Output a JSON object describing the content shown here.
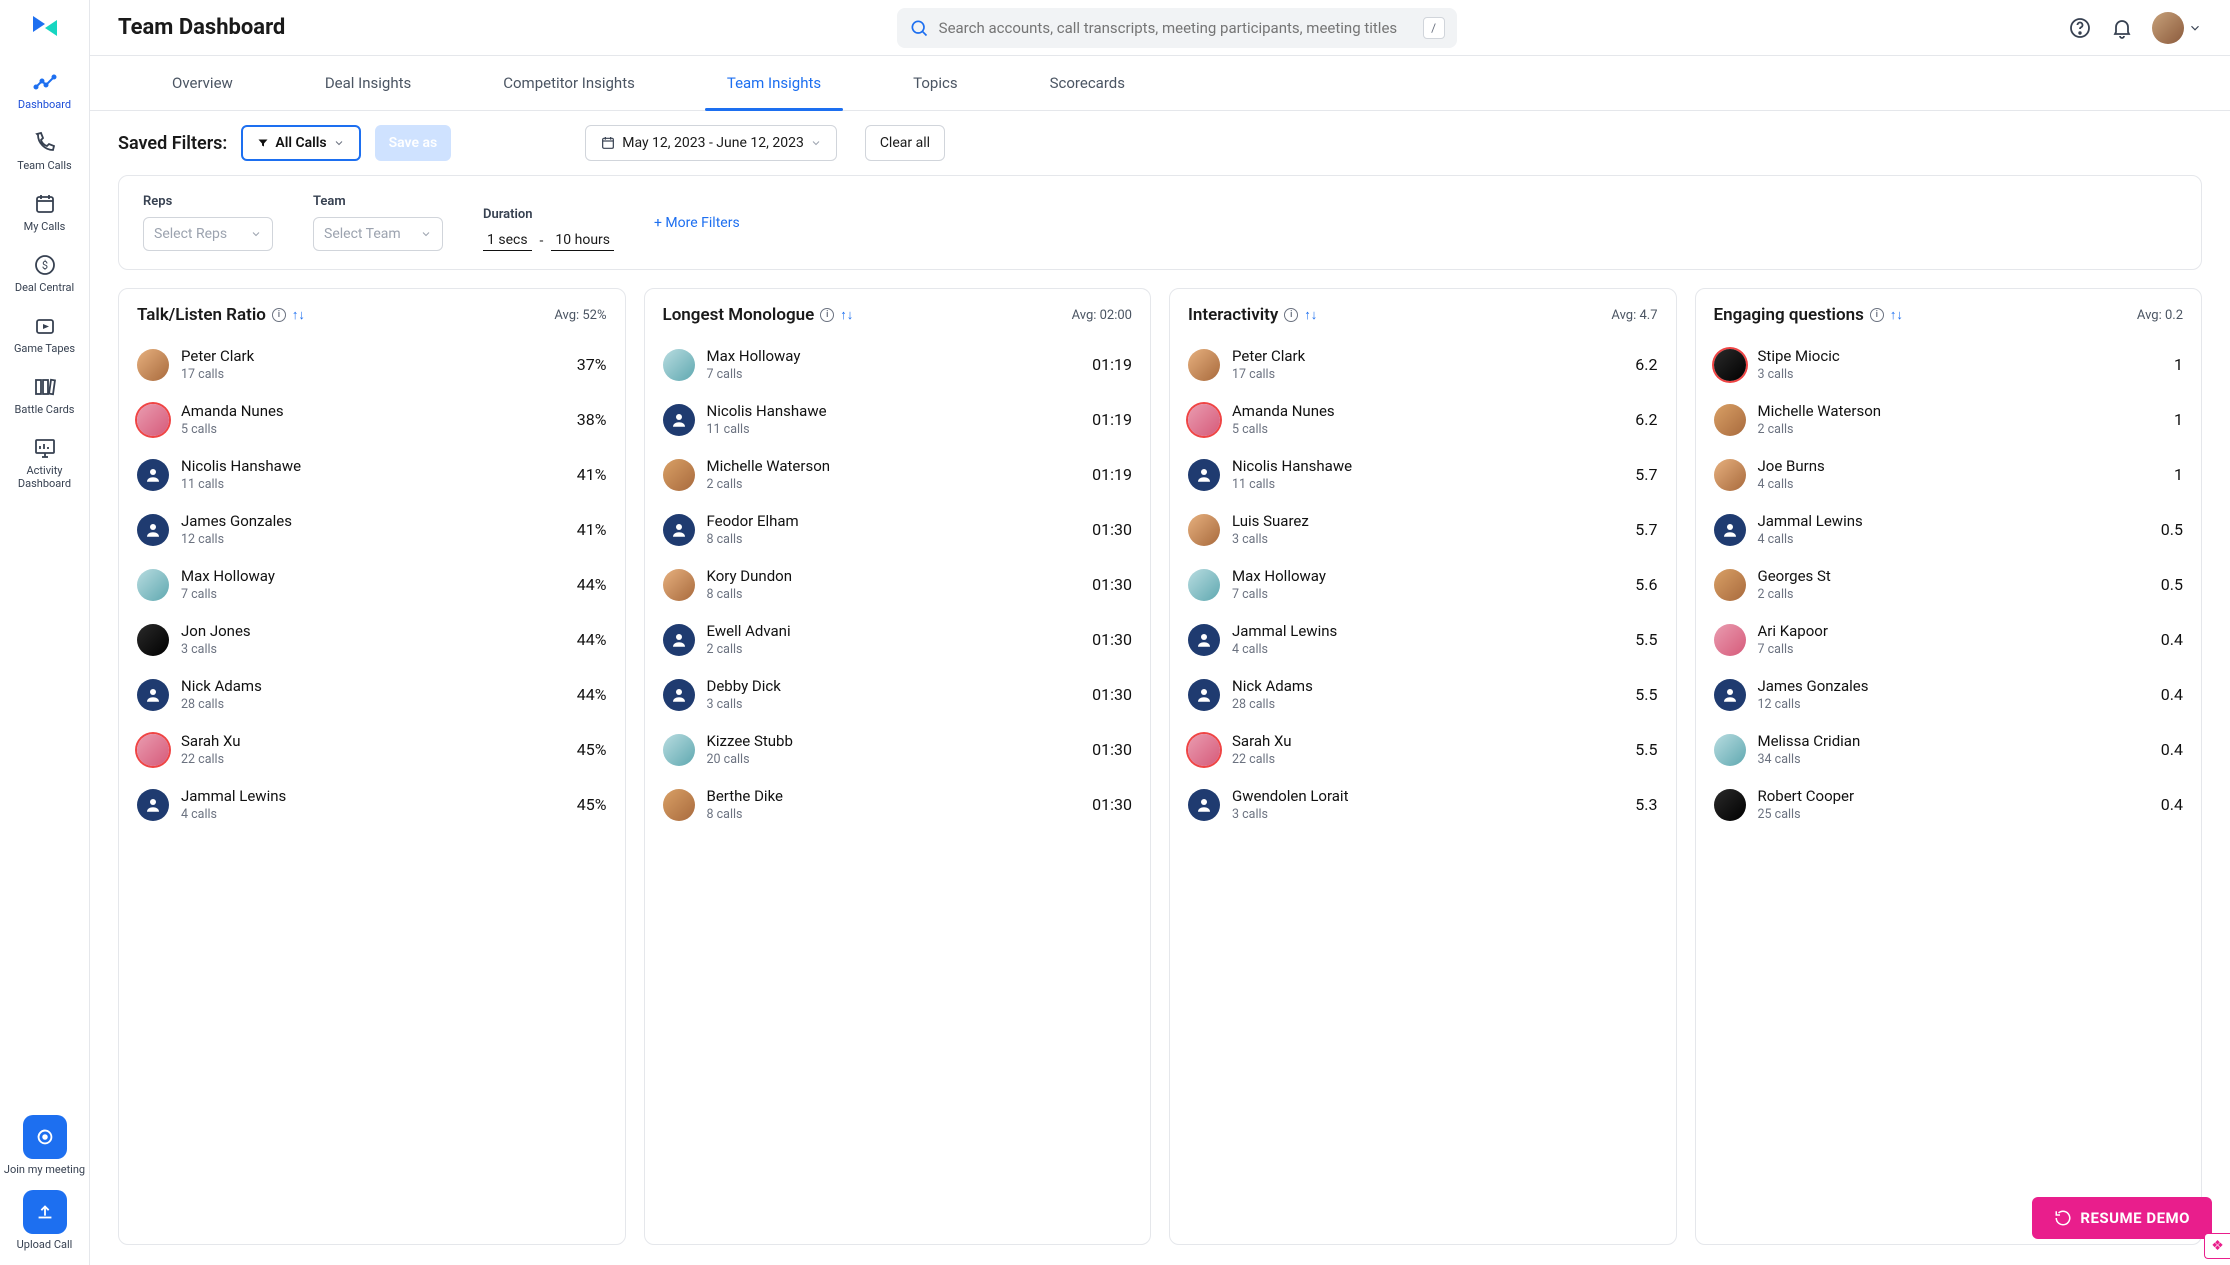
{
  "header": {
    "title": "Team Dashboard",
    "search_placeholder": "Search accounts, call transcripts, meeting participants, meeting titles",
    "search_kbd": "/"
  },
  "sidenav": {
    "items": [
      {
        "label": "Dashboard"
      },
      {
        "label": "Team Calls"
      },
      {
        "label": "My Calls"
      },
      {
        "label": "Deal Central"
      },
      {
        "label": "Game Tapes"
      },
      {
        "label": "Battle Cards"
      },
      {
        "label": "Activity Dashboard"
      }
    ],
    "join_label": "Join my meeting",
    "upload_label": "Upload Call"
  },
  "tabs": [
    {
      "label": "Overview"
    },
    {
      "label": "Deal Insights"
    },
    {
      "label": "Competitor Insights"
    },
    {
      "label": "Team Insights"
    },
    {
      "label": "Topics"
    },
    {
      "label": "Scorecards"
    }
  ],
  "active_tab": 3,
  "filters": {
    "saved_label": "Saved Filters:",
    "all_calls": "All Calls",
    "save_as": "Save as",
    "date_range": "May 12, 2023 - June 12, 2023",
    "clear": "Clear all",
    "reps_label": "Reps",
    "reps_placeholder": "Select Reps",
    "team_label": "Team",
    "team_placeholder": "Select Team",
    "duration_label": "Duration",
    "duration_min": "1 secs",
    "duration_max": "10 hours",
    "more": "+ More Filters"
  },
  "columns": [
    {
      "title": "Talk/Listen Ratio",
      "avg_label": "Avg: 52%",
      "rows": [
        {
          "name": "Peter Clark",
          "sub": "17 calls",
          "val": "37%",
          "av": "photo1"
        },
        {
          "name": "Amanda Nunes",
          "sub": "5 calls",
          "val": "38%",
          "av": "photo2 ring"
        },
        {
          "name": "Nicolis Hanshawe",
          "sub": "11 calls",
          "val": "41%",
          "av": ""
        },
        {
          "name": "James Gonzales",
          "sub": "12 calls",
          "val": "41%",
          "av": ""
        },
        {
          "name": "Max Holloway",
          "sub": "7 calls",
          "val": "44%",
          "av": "photo3"
        },
        {
          "name": "Jon Jones",
          "sub": "3 calls",
          "val": "44%",
          "av": "photo4"
        },
        {
          "name": "Nick Adams",
          "sub": "28 calls",
          "val": "44%",
          "av": ""
        },
        {
          "name": "Sarah Xu",
          "sub": "22 calls",
          "val": "45%",
          "av": "photo2 ring"
        },
        {
          "name": "Jammal Lewins",
          "sub": "4 calls",
          "val": "45%",
          "av": ""
        }
      ]
    },
    {
      "title": "Longest Monologue",
      "avg_label": "Avg: 02:00",
      "rows": [
        {
          "name": "Max Holloway",
          "sub": "7 calls",
          "val": "01:19",
          "av": "photo3"
        },
        {
          "name": "Nicolis Hanshawe",
          "sub": "11 calls",
          "val": "01:19",
          "av": ""
        },
        {
          "name": "Michelle Waterson",
          "sub": "2 calls",
          "val": "01:19",
          "av": "photo5"
        },
        {
          "name": "Feodor Elham",
          "sub": "8 calls",
          "val": "01:30",
          "av": ""
        },
        {
          "name": "Kory Dundon",
          "sub": "8 calls",
          "val": "01:30",
          "av": "photo1"
        },
        {
          "name": "Ewell Advani",
          "sub": "2 calls",
          "val": "01:30",
          "av": ""
        },
        {
          "name": "Debby Dick",
          "sub": "3 calls",
          "val": "01:30",
          "av": ""
        },
        {
          "name": "Kizzee Stubb",
          "sub": "20 calls",
          "val": "01:30",
          "av": "photo3"
        },
        {
          "name": "Berthe Dike",
          "sub": "8 calls",
          "val": "01:30",
          "av": "photo5"
        }
      ]
    },
    {
      "title": "Interactivity",
      "avg_label": "Avg: 4.7",
      "rows": [
        {
          "name": "Peter Clark",
          "sub": "17 calls",
          "val": "6.2",
          "av": "photo1"
        },
        {
          "name": "Amanda Nunes",
          "sub": "5 calls",
          "val": "6.2",
          "av": "photo2 ring"
        },
        {
          "name": "Nicolis Hanshawe",
          "sub": "11 calls",
          "val": "5.7",
          "av": ""
        },
        {
          "name": "Luis Suarez",
          "sub": "3 calls",
          "val": "5.7",
          "av": "photo1"
        },
        {
          "name": "Max Holloway",
          "sub": "7 calls",
          "val": "5.6",
          "av": "photo3"
        },
        {
          "name": "Jammal Lewins",
          "sub": "4 calls",
          "val": "5.5",
          "av": ""
        },
        {
          "name": "Nick Adams",
          "sub": "28 calls",
          "val": "5.5",
          "av": ""
        },
        {
          "name": "Sarah Xu",
          "sub": "22 calls",
          "val": "5.5",
          "av": "photo2 ring"
        },
        {
          "name": "Gwendolen Lorait",
          "sub": "3 calls",
          "val": "5.3",
          "av": ""
        }
      ]
    },
    {
      "title": "Engaging questions",
      "avg_label": "Avg: 0.2",
      "rows": [
        {
          "name": "Stipe Miocic",
          "sub": "3 calls",
          "val": "1",
          "av": "photo4 ring"
        },
        {
          "name": "Michelle Waterson",
          "sub": "2 calls",
          "val": "1",
          "av": "photo5"
        },
        {
          "name": "Joe Burns",
          "sub": "4 calls",
          "val": "1",
          "av": "photo1"
        },
        {
          "name": "Jammal Lewins",
          "sub": "4 calls",
          "val": "0.5",
          "av": ""
        },
        {
          "name": "Georges St",
          "sub": "2 calls",
          "val": "0.5",
          "av": "photo5"
        },
        {
          "name": "Ari Kapoor",
          "sub": "7 calls",
          "val": "0.4",
          "av": "photo2"
        },
        {
          "name": "James Gonzales",
          "sub": "12 calls",
          "val": "0.4",
          "av": ""
        },
        {
          "name": "Melissa Cridian",
          "sub": "34 calls",
          "val": "0.4",
          "av": "photo3"
        },
        {
          "name": "Robert Cooper",
          "sub": "25 calls",
          "val": "0.4",
          "av": "photo4"
        }
      ]
    }
  ],
  "resume_demo": "RESUME DEMO"
}
